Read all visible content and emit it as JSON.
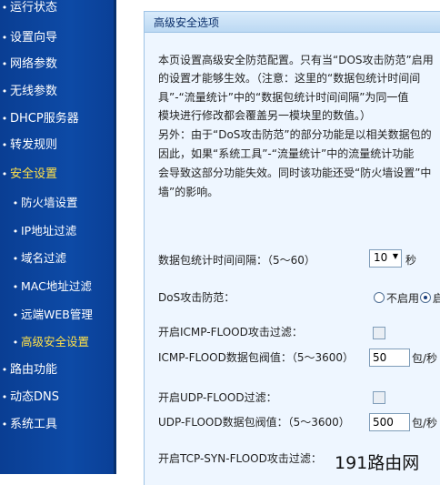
{
  "sidebar": {
    "items": [
      {
        "label": "运行状态"
      },
      {
        "label": "设置向导"
      },
      {
        "label": "网络参数"
      },
      {
        "label": "无线参数"
      },
      {
        "label": "DHCP服务器"
      },
      {
        "label": "转发规则"
      },
      {
        "label": "安全设置"
      },
      {
        "label": "防火墙设置"
      },
      {
        "label": "IP地址过滤"
      },
      {
        "label": "域名过滤"
      },
      {
        "label": "MAC地址过滤"
      },
      {
        "label": "远端WEB管理"
      },
      {
        "label": "高级安全设置"
      },
      {
        "label": "路由功能"
      },
      {
        "label": "动态DNS"
      },
      {
        "label": "系统工具"
      }
    ]
  },
  "panel": {
    "title": "高级安全选项",
    "description": [
      "本页设置高级安全防范配置。只有当“DOS攻击防范”启用",
      "的设置才能够生效。（注意：这里的“数据包统计时间间",
      "具”-“流量统计”中的“数据包统计时间间隔”为同一值",
      "模块进行修改都会覆盖另一模块里的数值。）",
      "另外：由于“DoS攻击防范”的部分功能是以相关数据包的",
      "因此，如果“系统工具”-“流量统计”中的流量统计功能",
      "会导致这部分功能失效。同时该功能还受“防火墙设置”中",
      "墙”的影响。"
    ],
    "interval_label": "数据包统计时间间隔：（5～60）",
    "interval_value": "10",
    "interval_unit": "秒",
    "dos_label": "DoS攻击防范：",
    "dos_disable": "不启用",
    "dos_enable_partial": "启",
    "icmp_enable_label": "开启ICMP-FLOOD攻击过滤：",
    "icmp_threshold_label": "ICMP-FLOOD数据包阀值：（5～3600）",
    "icmp_threshold_value": "50",
    "icmp_unit": "包/秒",
    "udp_enable_label": "开启UDP-FLOOD过滤：",
    "udp_threshold_label": "UDP-FLOOD数据包阀值：（5～3600）",
    "udp_threshold_value": "500",
    "udp_unit": "包/秒",
    "tcp_enable_label": "开启TCP-SYN-FLOOD攻击过滤："
  },
  "watermark": "191路由网",
  "colors": {
    "sidebar_bg": "#0d4aa6",
    "highlight_text": "#ffe14a",
    "panel_bg": "#eef6ff"
  }
}
